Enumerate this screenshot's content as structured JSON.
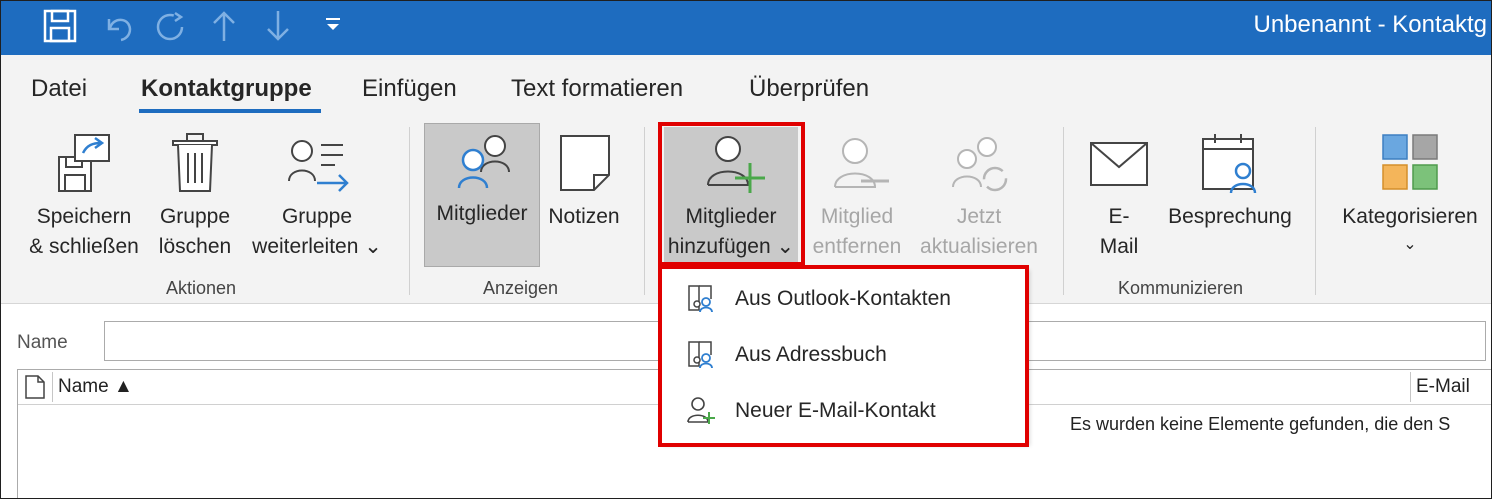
{
  "titlebar": {
    "title": "Unbenannt  -  Kontaktg",
    "qat_icons": [
      "save-icon",
      "undo-icon",
      "redo-icon",
      "up-arrow-icon",
      "down-arrow-icon",
      "customize-qat-icon"
    ]
  },
  "tabs": [
    {
      "label": "Datei"
    },
    {
      "label": "Kontaktgruppe",
      "active": true
    },
    {
      "label": "Einfügen"
    },
    {
      "label": "Text formatieren"
    },
    {
      "label": "Überprüfen"
    }
  ],
  "ribbon": {
    "groups": {
      "aktionen": "Aktionen",
      "anzeigen": "Anzeigen",
      "kommunizieren": "Kommunizieren"
    },
    "buttons": {
      "save_close": [
        "Speichern",
        "& schließen"
      ],
      "delete_group": [
        "Gruppe",
        "löschen"
      ],
      "forward_group": [
        "Gruppe",
        "weiterleiten ⌄"
      ],
      "members": "Mitglieder",
      "notes": "Notizen",
      "add_members": [
        "Mitglieder",
        "hinzufügen ⌄"
      ],
      "remove_member": [
        "Mitglied",
        "entfernen"
      ],
      "update_now": [
        "Jetzt",
        "aktualisieren"
      ],
      "email": [
        "E-",
        "Mail"
      ],
      "meeting": "Besprechung",
      "categorize": [
        "Kategorisieren",
        "⌄"
      ]
    }
  },
  "dropdown": {
    "items": [
      {
        "label": "Aus Outlook-Kontakten",
        "icon": "address-book-icon"
      },
      {
        "label": "Aus Adressbuch",
        "icon": "address-book-icon"
      },
      {
        "label": "Neuer E-Mail-Kontakt",
        "icon": "new-contact-icon"
      }
    ]
  },
  "form": {
    "name_label": "Name",
    "name_value": "",
    "columns": {
      "name": "Name ▲",
      "email": "E-Mail"
    },
    "empty_message": "Es wurden keine Elemente gefunden, die den S"
  },
  "colors": {
    "titlebar": "#1e6cbf",
    "highlight": "#e00000",
    "accent_green": "#4aa84a",
    "accent_blue": "#2f7fd0"
  }
}
